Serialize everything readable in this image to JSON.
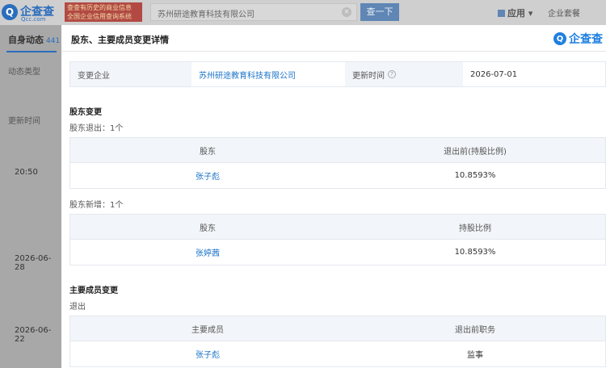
{
  "background": {
    "logo": {
      "mark": "Q",
      "text": "企查查",
      "sub": "Qcc.com"
    },
    "banner": "查查有历史的商业信息\n全国企业信用查询系统",
    "search": {
      "value": "苏州研途教育科技有限公司"
    },
    "search_button": "查一下",
    "app_menu": "应用",
    "package_menu": "企业套餐",
    "tab": {
      "label": "自身动态",
      "count": "441"
    },
    "filter_label": "动态类型",
    "update_header": "更新时间",
    "timeline_dates": [
      "20:50",
      "2026-06-28",
      "2026-06-22"
    ]
  },
  "panel": {
    "title": "股东、主要成员变更详情",
    "logo": {
      "mark": "Q",
      "text": "企查查"
    },
    "info": {
      "company_label": "变更企业",
      "company_value": "苏州研途教育科技有限公司",
      "time_label": "更新时间",
      "time_value": "2026-07-01"
    },
    "shareholder_section": "股东变更",
    "exit_title": "股东退出：1个",
    "exit_table": {
      "headers": [
        "股东",
        "退出前(持股比例)"
      ],
      "rows": [
        [
          "张子彪",
          "10.8593%"
        ]
      ]
    },
    "add_title": "股东新增：1个",
    "add_table": {
      "headers": [
        "股东",
        "持股比例"
      ],
      "rows": [
        [
          "张婷茜",
          "10.8593%"
        ]
      ]
    },
    "member_section": "主要成员变更",
    "member_exit_title": "退出",
    "member_table": {
      "headers": [
        "主要成员",
        "退出前职务"
      ],
      "rows": [
        [
          "张子彪",
          "监事"
        ]
      ]
    }
  }
}
